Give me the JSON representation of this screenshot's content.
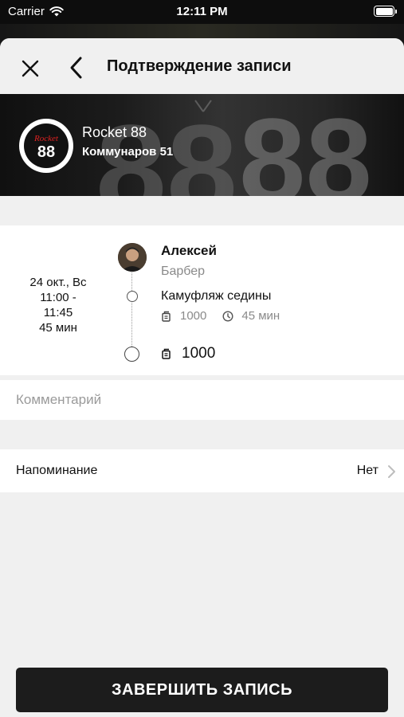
{
  "status_bar": {
    "carrier": "Carrier",
    "time": "12:11 PM"
  },
  "header": {
    "title": "Подтверждение записи"
  },
  "salon": {
    "name": "Rocket 88",
    "address": "Коммунаров 51",
    "logo_text": "88",
    "logo_script": "Rocket"
  },
  "appointment": {
    "date": "24 окт., Вс",
    "time_start": "11:00 -",
    "time_end": "11:45",
    "duration": "45 мин",
    "master": {
      "name": "Алексей",
      "role": "Барбер"
    },
    "service": {
      "name": "Камуфляж седины",
      "price": "1000",
      "duration": "45 мин"
    },
    "total": "1000"
  },
  "comment": {
    "placeholder": "Комментарий",
    "value": ""
  },
  "reminder": {
    "label": "Напоминание",
    "value": "Нет"
  },
  "actions": {
    "finish_label": "ЗАВЕРШИТЬ ЗАПИСЬ"
  },
  "icons": {
    "close": "close-icon",
    "back": "chevron-left-icon",
    "wifi": "wifi-icon",
    "battery": "battery-icon",
    "price": "price-tag-icon",
    "clock": "clock-icon",
    "chevron": "chevron-right-icon"
  },
  "colors": {
    "button": "#1c1c1c",
    "background": "#f0f0f0",
    "muted_text": "#8a8a8a"
  }
}
